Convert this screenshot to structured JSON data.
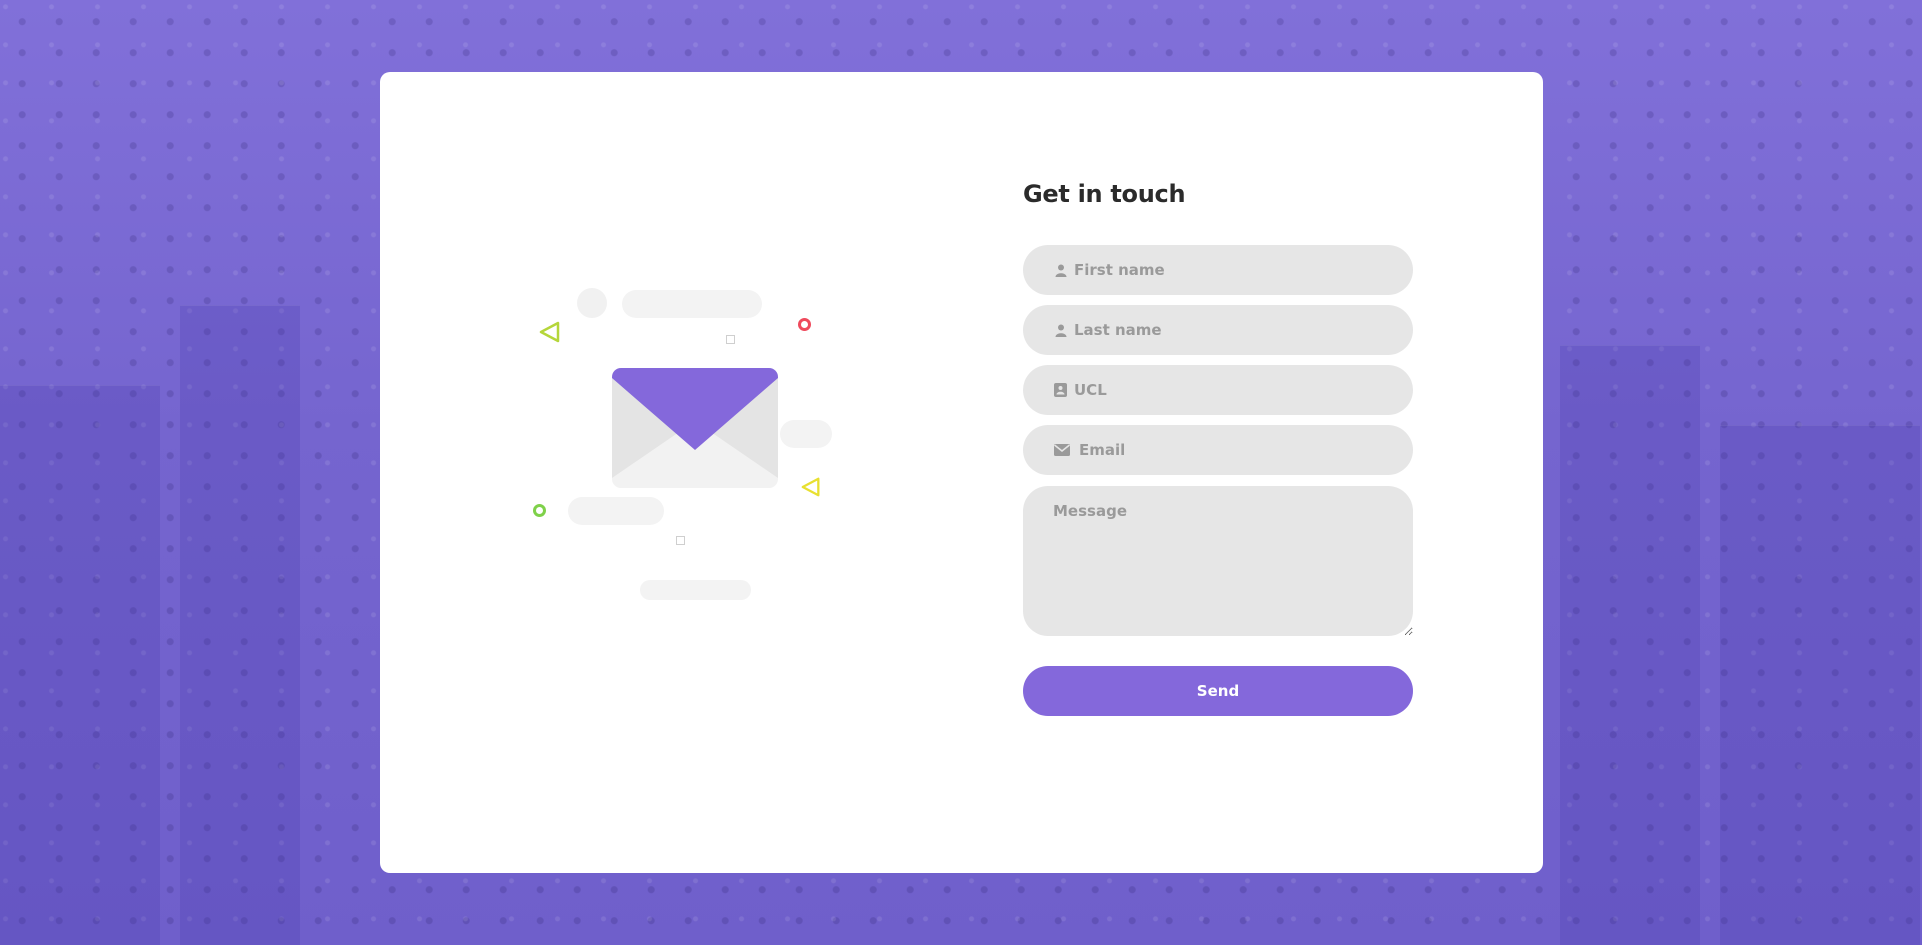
{
  "colors": {
    "accent": "#8468db",
    "background": "#7a68d6",
    "field": "#e6e6e6",
    "title": "#2b2b2b",
    "triangle_green": "#b5d63a",
    "triangle_yellow": "#e8e030",
    "ring_red": "#ef4a5c",
    "ring_green": "#7fd14a"
  },
  "form": {
    "title": "Get in touch",
    "fields": {
      "first_name": {
        "placeholder": "First name",
        "icon": "user-icon"
      },
      "last_name": {
        "placeholder": "Last name",
        "icon": "user-icon"
      },
      "ucl": {
        "placeholder": "UCL",
        "icon": "id-card-icon"
      },
      "email": {
        "placeholder": "Email",
        "icon": "envelope-icon"
      },
      "message": {
        "placeholder": "Message"
      }
    },
    "send_label": "Send"
  }
}
